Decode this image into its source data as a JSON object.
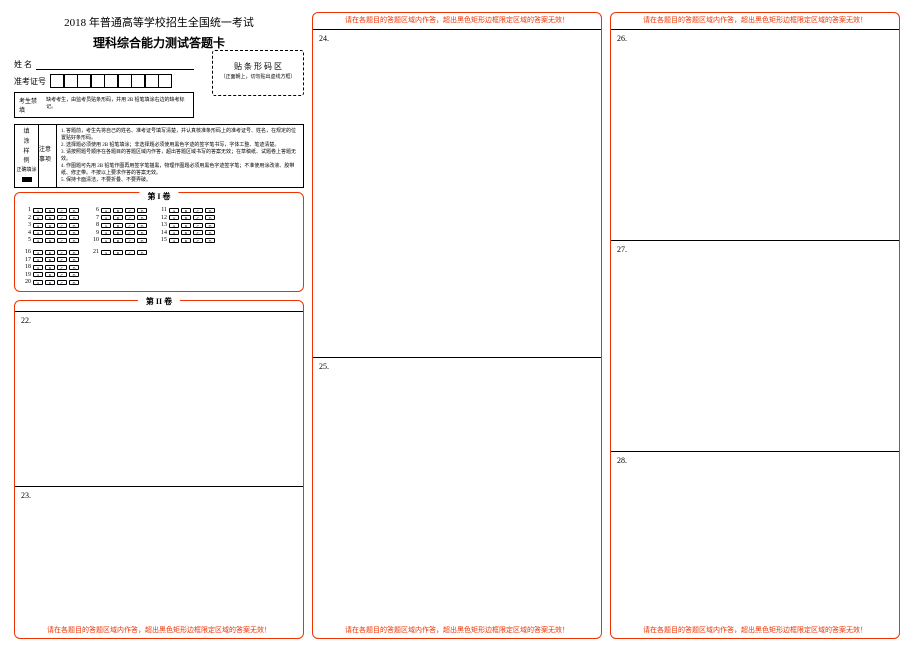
{
  "header": {
    "title": "2018 年普通高等学校招生全国统一考试",
    "subtitle": "理科综合能力测试答题卡"
  },
  "info": {
    "name_label": "姓    名",
    "id_label": "准考证号"
  },
  "barcode": {
    "title": "贴 条 形 码 区",
    "sub": "（正面朝上，切勿贴出虚线方框）"
  },
  "warn": {
    "label": "考生禁填",
    "text": "缺考考生，由监考员贴条形码，并用 2B 铅笔填涂右边的缺考标记。"
  },
  "instructions": {
    "left_title_1": "填",
    "left_title_2": "涂",
    "left_title_3": "样",
    "left_title_4": "例",
    "left_sub": "正确填涂",
    "mid_title": "注意事项",
    "items": [
      "1. 答题前，考生先将自己的姓名、准考证号填写清楚，并认真核准条形码上的准考证号、姓名，在规定的位置贴好条形码。",
      "2. 选择题必须使用 2B 铅笔填涂；非选择题必须使用黑色字迹的签字笔书写，字体工整、笔迹清楚。",
      "3. 请按照题号顺序在各题目的答题区域内作答，超出答题区域书写的答案无效；在草稿纸、试题卷上答题无效。",
      "4. 作图题可先用 2B 铅笔作图再用签字笔描黑，物理作图题必须用黑色字迹签字笔；不准使用涂改液、胶带纸、修正带。不按以上要求作答的答案无效。",
      "5. 保持卡面清洁，不要折叠、不要弄破。"
    ]
  },
  "sections": {
    "part1": "第 I 卷",
    "part2": "第 II 卷"
  },
  "mc": {
    "options": [
      "A",
      "B",
      "C",
      "D"
    ],
    "group1": [
      1,
      2,
      3,
      4,
      5
    ],
    "group2": [
      6,
      7,
      8,
      9,
      10
    ],
    "group3": [
      11,
      12,
      13,
      14,
      15
    ],
    "group4": [
      16,
      17,
      18,
      19,
      20
    ],
    "group5": [
      21
    ]
  },
  "answers": {
    "q22": "22.",
    "q23": "23.",
    "q24": "24.",
    "q25": "25.",
    "q26": "26.",
    "q27": "27.",
    "q28": "28."
  },
  "warnings": {
    "footer": "请在各题目的答题区域内作答，超出黑色矩形边框限定区域的答案无效！",
    "header": "请在各题目的答题区域内作答，超出黑色矩形边框限定区域的答案无效！"
  }
}
